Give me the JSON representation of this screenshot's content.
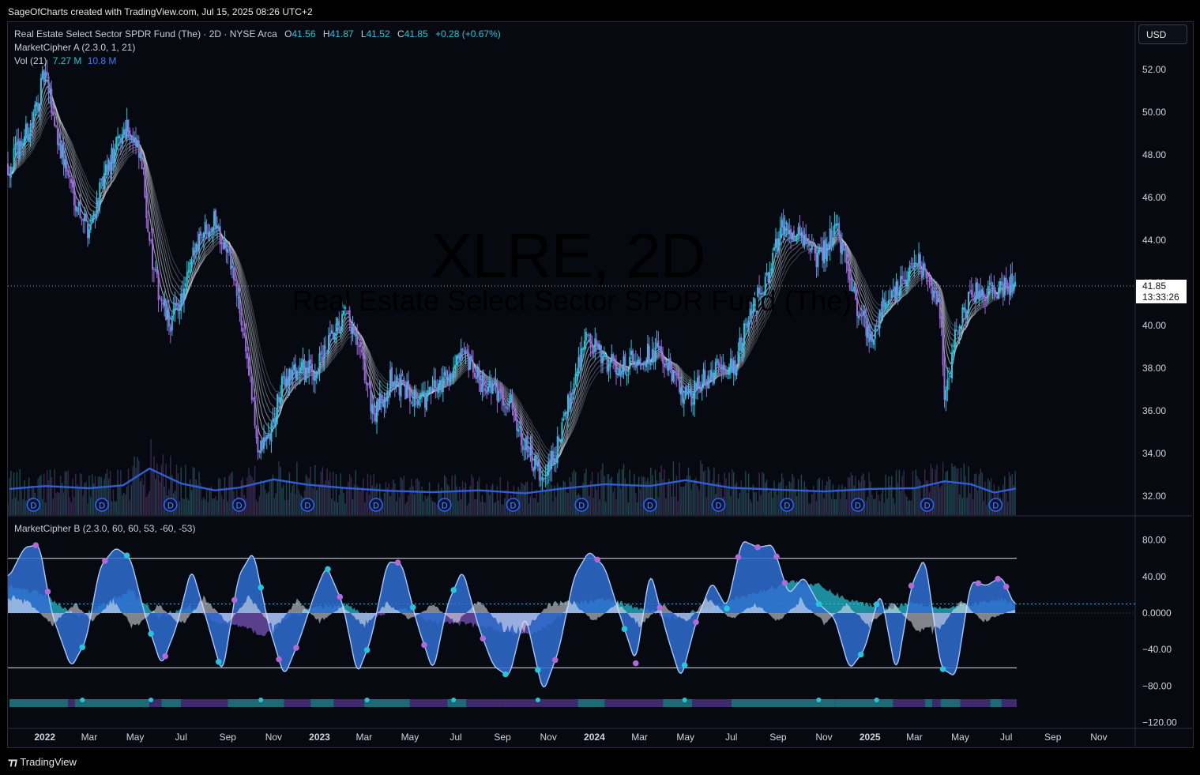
{
  "header": {
    "attribution": "SageOfCharts created with TradingView.com, Jul 15, 2025 08:26 UTC+2"
  },
  "footer": {
    "brand": "TradingView"
  },
  "watermark": {
    "symbol": "XLRE, 2D",
    "name": "Real Estate Select Sector SPDR Fund (The)"
  },
  "legend": {
    "instrument": "Real Estate Select Sector SPDR Fund (The) · 2D · NYSE Arca",
    "open_label": "O",
    "open": "41.56",
    "high_label": "H",
    "high": "41.87",
    "low_label": "L",
    "low": "41.52",
    "close_label": "C",
    "close": "41.85",
    "change": "+0.28 (+0.67%)",
    "indicator_a": "MarketCipher A (2.3.0, 1, 21)",
    "vol_label": "Vol (21)",
    "vol_value": "7.27 M",
    "vol_ma": "10.8 M",
    "indicator_b": "MarketCipher B (2.3.0, 60, 60, 53, -60, -53)"
  },
  "currency_button": "USD",
  "last_price": {
    "value": "41.85",
    "countdown": "13:33:26"
  },
  "colors": {
    "background": "#06090f",
    "bull_candle": "#26c6da",
    "bear_candle": "#9c6ade",
    "ribbon": "#cfd4de",
    "volume_ma": "#2f5fd6",
    "wave_fill": "#2f6fd1",
    "money_flow_pos": "#26c6da",
    "money_flow_neg": "#7e57c2",
    "dot_buy": "#26c6da",
    "dot_sell": "#b36ad8"
  },
  "chart_data": [
    {
      "type": "candlestick",
      "title": "XLRE, 2D",
      "price_axis": {
        "ylim": [
          31,
          53.5
        ],
        "ticks": [
          "52.00",
          "50.00",
          "48.00",
          "46.00",
          "44.00",
          "42.00",
          "40.00",
          "38.00",
          "36.00",
          "34.00",
          "32.00"
        ]
      },
      "time_axis": {
        "labels": [
          "2022",
          "Mar",
          "May",
          "Jul",
          "Sep",
          "Nov",
          "2023",
          "Mar",
          "May",
          "Jul",
          "Sep",
          "Nov",
          "2024",
          "Mar",
          "May",
          "Jul",
          "Sep",
          "Nov",
          "2025",
          "Mar",
          "May",
          "Jul",
          "Sep",
          "Nov"
        ],
        "bold": [
          "2022",
          "2023",
          "2024",
          "2025"
        ]
      },
      "close_path": {
        "dates": [
          "2021-11-15",
          "2021-12-15",
          "2022-01-01",
          "2022-01-20",
          "2022-02-10",
          "2022-02-28",
          "2022-03-25",
          "2022-04-20",
          "2022-05-10",
          "2022-05-25",
          "2022-06-15",
          "2022-07-05",
          "2022-07-25",
          "2022-08-15",
          "2022-09-05",
          "2022-09-25",
          "2022-10-12",
          "2022-10-28",
          "2022-11-15",
          "2022-12-05",
          "2022-12-25",
          "2023-01-20",
          "2023-02-05",
          "2023-02-25",
          "2023-03-15",
          "2023-04-05",
          "2023-04-25",
          "2023-05-20",
          "2023-06-15",
          "2023-07-10",
          "2023-07-31",
          "2023-08-20",
          "2023-09-10",
          "2023-10-05",
          "2023-10-25",
          "2023-11-15",
          "2023-12-05",
          "2023-12-20",
          "2024-01-10",
          "2024-02-01",
          "2024-02-28",
          "2024-03-25",
          "2024-04-15",
          "2024-05-05",
          "2024-05-25",
          "2024-06-15",
          "2024-07-05",
          "2024-07-25",
          "2024-08-15",
          "2024-09-05",
          "2024-09-20",
          "2024-10-10",
          "2024-10-25",
          "2024-11-15",
          "2024-11-30",
          "2024-12-15",
          "2025-01-05",
          "2025-01-25",
          "2025-02-15",
          "2025-03-05",
          "2025-03-25",
          "2025-04-05",
          "2025-04-10",
          "2025-04-25",
          "2025-05-15",
          "2025-06-05",
          "2025-06-25",
          "2025-07-14"
        ],
        "close": [
          47.5,
          49.5,
          51.8,
          48.5,
          46.0,
          44.5,
          47.3,
          49.5,
          47.5,
          42.5,
          40.0,
          41.5,
          44.3,
          45.0,
          43.0,
          39.0,
          34.0,
          35.0,
          37.5,
          38.0,
          37.8,
          39.5,
          40.5,
          38.5,
          35.7,
          37.5,
          37.0,
          36.5,
          37.5,
          38.5,
          37.5,
          37.0,
          36.5,
          34.0,
          32.6,
          34.5,
          37.5,
          39.5,
          38.5,
          38.0,
          38.5,
          38.8,
          37.5,
          36.5,
          37.5,
          38.0,
          38.0,
          40.5,
          42.0,
          44.5,
          44.5,
          44.0,
          43.0,
          44.5,
          43.5,
          40.5,
          39.5,
          41.5,
          42.0,
          43.0,
          41.5,
          40.5,
          36.5,
          39.5,
          41.5,
          41.5,
          41.8,
          41.85
        ]
      },
      "volume_ma_path": {
        "dates": [
          "2021-11-15",
          "2022-01-01",
          "2022-03-01",
          "2022-04-15",
          "2022-05-20",
          "2022-07-01",
          "2022-08-15",
          "2022-09-15",
          "2022-11-01",
          "2022-12-15",
          "2023-02-01",
          "2023-04-01",
          "2023-06-01",
          "2023-08-01",
          "2023-10-01",
          "2023-11-15",
          "2024-01-15",
          "2024-03-15",
          "2024-05-01",
          "2024-07-01",
          "2024-09-01",
          "2024-11-01",
          "2025-01-01",
          "2025-03-01",
          "2025-04-10",
          "2025-05-15",
          "2025-06-15",
          "2025-07-14"
        ],
        "volume_millions": [
          7.2,
          8.0,
          7.4,
          8.2,
          12.8,
          8.7,
          6.8,
          7.5,
          9.8,
          8.4,
          7.5,
          6.7,
          6.3,
          6.8,
          6.0,
          7.2,
          8.5,
          8.0,
          9.6,
          7.5,
          7.0,
          6.5,
          7.2,
          7.4,
          9.3,
          8.5,
          6.2,
          7.3
        ]
      },
      "dividend_markers": {
        "label": "D",
        "dates": [
          "2021-12-17",
          "2022-03-18",
          "2022-06-17",
          "2022-09-16",
          "2022-12-16",
          "2023-03-17",
          "2023-06-16",
          "2023-09-15",
          "2023-12-15",
          "2024-03-15",
          "2024-06-14",
          "2024-09-13",
          "2024-12-16",
          "2025-03-18",
          "2025-06-17"
        ]
      }
    },
    {
      "type": "area",
      "title": "MarketCipher B (2.3.0, 60, 60, 53, -60, -53)",
      "ylim": [
        -120,
        92
      ],
      "ticks": [
        "80.00",
        "40.00",
        "0.0000",
        "-40.00",
        "-80.00",
        "-120.00"
      ],
      "levels": [
        60,
        10,
        -60
      ],
      "wave": {
        "dates": [
          "2021-11-15",
          "2021-12-05",
          "2021-12-25",
          "2022-01-10",
          "2022-02-05",
          "2022-02-25",
          "2022-03-15",
          "2022-04-05",
          "2022-04-25",
          "2022-05-15",
          "2022-06-05",
          "2022-06-25",
          "2022-07-15",
          "2022-08-05",
          "2022-08-25",
          "2022-09-15",
          "2022-10-05",
          "2022-10-25",
          "2022-11-15",
          "2022-12-05",
          "2022-12-25",
          "2023-01-10",
          "2023-02-01",
          "2023-02-20",
          "2023-03-10",
          "2023-04-01",
          "2023-04-20",
          "2023-05-10",
          "2023-06-01",
          "2023-06-20",
          "2023-07-10",
          "2023-07-31",
          "2023-08-20",
          "2023-09-10",
          "2023-10-01",
          "2023-10-25",
          "2023-11-15",
          "2023-12-05",
          "2023-12-25",
          "2024-01-15",
          "2024-02-05",
          "2024-02-25",
          "2024-03-15",
          "2024-04-05",
          "2024-04-25",
          "2024-05-15",
          "2024-06-05",
          "2024-06-25",
          "2024-07-15",
          "2024-08-05",
          "2024-08-25",
          "2024-09-15",
          "2024-10-05",
          "2024-10-25",
          "2024-11-15",
          "2024-12-05",
          "2024-12-25",
          "2025-01-15",
          "2025-02-05",
          "2025-02-25",
          "2025-03-15",
          "2025-04-05",
          "2025-04-25",
          "2025-05-15",
          "2025-06-05",
          "2025-06-25",
          "2025-07-14"
        ],
        "values": [
          40,
          72,
          75,
          0,
          -60,
          -30,
          50,
          72,
          60,
          -5,
          -58,
          -15,
          50,
          -10,
          -68,
          40,
          68,
          -12,
          -70,
          -30,
          20,
          52,
          10,
          -68,
          -30,
          56,
          55,
          -10,
          -65,
          10,
          48,
          -15,
          -58,
          -70,
          0,
          -88,
          -40,
          40,
          68,
          50,
          -5,
          -55,
          48,
          -20,
          -73,
          -10,
          35,
          5,
          80,
          72,
          75,
          20,
          40,
          10,
          -5,
          -62,
          -40,
          25,
          -68,
          30,
          62,
          -60,
          -70,
          35,
          30,
          40,
          5
        ]
      },
      "money_flow": {
        "dates": [
          "2021-11-15",
          "2022-01-01",
          "2022-02-15",
          "2022-03-20",
          "2022-04-25",
          "2022-06-01",
          "2022-07-10",
          "2022-08-15",
          "2022-09-20",
          "2022-10-20",
          "2022-11-20",
          "2022-12-20",
          "2023-02-01",
          "2023-03-15",
          "2023-04-20",
          "2023-06-01",
          "2023-07-15",
          "2023-08-25",
          "2023-10-01",
          "2023-10-30",
          "2023-12-01",
          "2024-01-15",
          "2024-03-01",
          "2024-04-15",
          "2024-05-25",
          "2024-07-05",
          "2024-08-15",
          "2024-09-20",
          "2024-10-25",
          "2024-12-01",
          "2025-01-20",
          "2025-03-01",
          "2025-04-10",
          "2025-05-20",
          "2025-06-25",
          "2025-07-14"
        ],
        "values": [
          30,
          20,
          -5,
          10,
          25,
          -5,
          8,
          -10,
          -15,
          -25,
          -5,
          5,
          10,
          -5,
          5,
          -10,
          -12,
          -18,
          -25,
          -15,
          10,
          15,
          5,
          -5,
          5,
          15,
          25,
          35,
          30,
          15,
          5,
          12,
          5,
          10,
          15,
          8
        ]
      },
      "momentum": {
        "dates": [
          "2021-11-15",
          "2021-12-15",
          "2022-01-10",
          "2022-02-10",
          "2022-03-05",
          "2022-04-01",
          "2022-05-01",
          "2022-06-01",
          "2022-07-01",
          "2022-08-01",
          "2022-09-01",
          "2022-10-01",
          "2022-11-01",
          "2022-12-01",
          "2023-01-01",
          "2023-02-01",
          "2023-03-01",
          "2023-04-01",
          "2023-05-01",
          "2023-06-01",
          "2023-07-01",
          "2023-08-01",
          "2023-09-01",
          "2023-10-01",
          "2023-11-01",
          "2023-12-01",
          "2024-01-01",
          "2024-02-01",
          "2024-03-01",
          "2024-04-01",
          "2024-05-01",
          "2024-06-01",
          "2024-07-01",
          "2024-08-01",
          "2024-09-01",
          "2024-10-01",
          "2024-11-01",
          "2024-12-01",
          "2025-01-01",
          "2025-02-01",
          "2025-03-01",
          "2025-04-01",
          "2025-05-01",
          "2025-06-01",
          "2025-07-14"
        ],
        "values": [
          20,
          10,
          -15,
          12,
          -10,
          15,
          -20,
          10,
          -15,
          18,
          -12,
          20,
          -22,
          15,
          -10,
          8,
          -15,
          12,
          -8,
          10,
          -12,
          15,
          -18,
          -20,
          10,
          15,
          -10,
          12,
          -15,
          10,
          -12,
          18,
          -8,
          12,
          -10,
          15,
          -12,
          10,
          -15,
          12,
          -18,
          -22,
          15,
          -10,
          5
        ]
      },
      "buy_dots": [
        "2022-02-20",
        "2022-04-20",
        "2022-05-22",
        "2022-08-20",
        "2022-10-15",
        "2023-01-12",
        "2023-03-05",
        "2023-05-05",
        "2023-06-28",
        "2023-09-05",
        "2023-10-18",
        "2024-02-10",
        "2024-04-30",
        "2024-06-25",
        "2024-10-25",
        "2024-12-20",
        "2025-01-10",
        "2025-04-08"
      ],
      "sell_dots": [
        "2021-12-20",
        "2022-01-05",
        "2022-03-22",
        "2022-06-10",
        "2022-09-10",
        "2022-11-08",
        "2022-12-01",
        "2023-01-28",
        "2023-04-15",
        "2023-05-20",
        "2023-08-06",
        "2023-11-10",
        "2024-01-05",
        "2024-02-25",
        "2024-03-28",
        "2024-05-15",
        "2024-07-10",
        "2024-08-05",
        "2024-08-30",
        "2024-09-10",
        "2025-02-25",
        "2025-05-25",
        "2025-06-20",
        "2025-07-01"
      ],
      "signal_bar": {
        "dates": [
          "2021-11-15",
          "2022-02-01",
          "2022-02-10",
          "2022-05-20",
          "2022-06-05",
          "2022-07-01",
          "2022-09-01",
          "2022-11-15",
          "2022-12-20",
          "2023-01-20",
          "2023-03-01",
          "2023-05-01",
          "2023-06-20",
          "2023-07-15",
          "2023-09-01",
          "2023-12-10",
          "2024-01-15",
          "2024-04-01",
          "2024-05-10",
          "2024-07-01",
          "2024-11-15",
          "2025-02-01",
          "2025-03-15",
          "2025-03-25",
          "2025-04-05",
          "2025-05-01",
          "2025-06-10",
          "2025-06-25"
        ],
        "state": [
          "bull",
          "bear",
          "bull",
          "bear",
          "bull",
          "bear",
          "bull",
          "bear",
          "bull",
          "bear",
          "bull",
          "bear",
          "bull",
          "bear",
          "bear",
          "bull",
          "bear",
          "bull",
          "bear",
          "bull",
          "bull",
          "bear",
          "bull",
          "bear",
          "bull",
          "bear",
          "bull",
          "bear"
        ]
      }
    }
  ]
}
